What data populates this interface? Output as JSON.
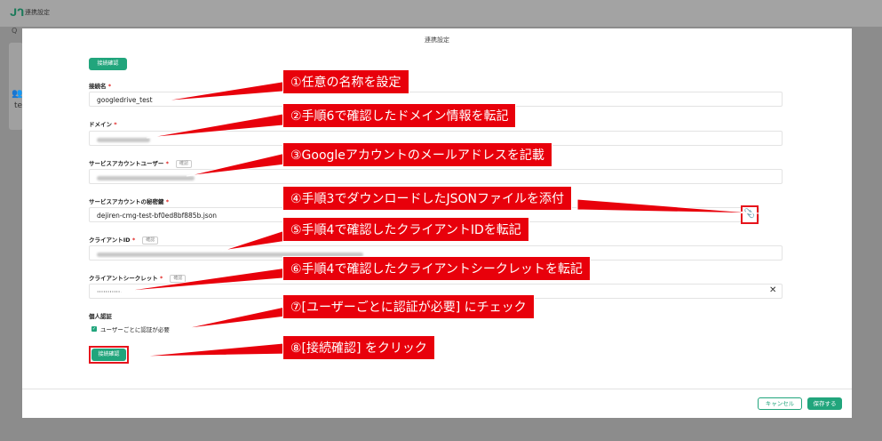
{
  "app": {
    "title": "連携設定",
    "search_glyph": "Q",
    "background_fragment": "te"
  },
  "modal": {
    "title": "連携設定",
    "test_button_top": "接続確認",
    "fields": [
      {
        "label": "接続名",
        "value": "googledrive_test"
      },
      {
        "label": "ドメイン",
        "value": ""
      },
      {
        "label": "サービスアカウントユーザー",
        "tag": "確認",
        "value": ""
      },
      {
        "label": "サービスアカウントの秘密鍵",
        "value": "dejiren-cmg-test-bf0ed8bf885b.json"
      },
      {
        "label": "クライアントID",
        "tag": "確認",
        "value": ""
      },
      {
        "label": "クライアントシークレット",
        "tag": "確認",
        "value": "············"
      }
    ],
    "personal_auth": {
      "heading": "個人認証",
      "checkbox_label": "ユーザーごとに認証が必要",
      "checked": true
    },
    "test_button_bottom": "接続確認",
    "footer": {
      "cancel_label": "キャンセル",
      "save_label": "保存する"
    }
  },
  "callouts": [
    "①任意の名称を設定",
    "②手順6で確認したドメイン情報を転記",
    "③Googleアカウントのメールアドレスを記載",
    "④手順3でダウンロードしたJSONファイルを添付",
    "⑤手順4で確認したクライアントIDを転記",
    "⑥手順4で確認したクライアントシークレットを転記",
    "⑦[ユーザーごとに認証が必要] にチェック",
    "⑧[接続確認] をクリック"
  ],
  "colors": {
    "accent": "#21a57c",
    "callout": "#e8000b",
    "required": "#e0201e"
  }
}
